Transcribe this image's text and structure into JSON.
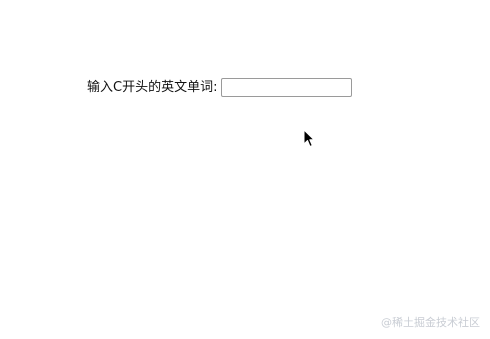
{
  "form": {
    "label": "输入C开头的英文单词:",
    "input_value": "",
    "input_placeholder": ""
  },
  "watermark": {
    "text": "@稀土掘金技术社区"
  }
}
